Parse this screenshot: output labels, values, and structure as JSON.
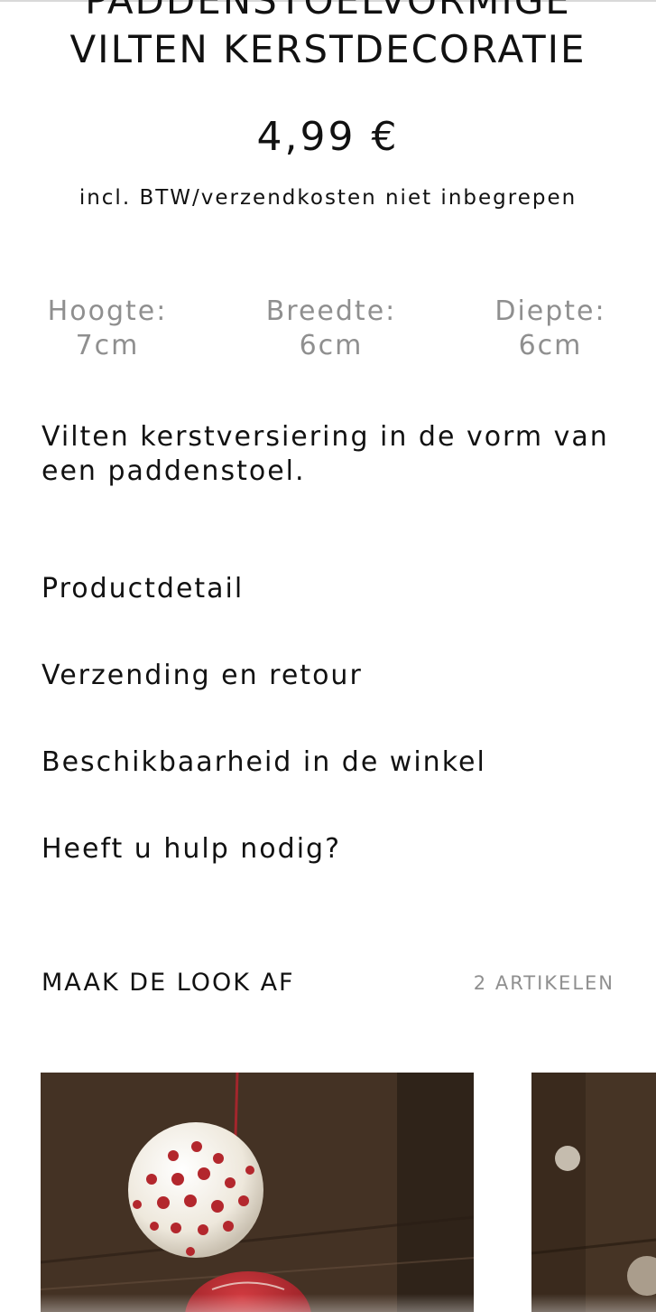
{
  "product": {
    "title_line_1": "PADDENSTOELVORMIGE",
    "title_line_2": "VILTEN KERSTDECORATIE",
    "price": "4,99 €",
    "tax_note": "incl. BTW/verzendkosten niet inbegrepen",
    "dimensions": [
      {
        "label": "Hoogte:",
        "value": "7cm"
      },
      {
        "label": "Breedte:",
        "value": "6cm"
      },
      {
        "label": "Diepte:",
        "value": "6cm"
      }
    ],
    "description": "Vilten kerstversiering in de vorm van een paddenstoel."
  },
  "sections": [
    {
      "label": "Productdetail"
    },
    {
      "label": "Verzending en retour"
    },
    {
      "label": "Beschikbaarheid in de winkel"
    },
    {
      "label": "Heeft u hulp nodig?"
    }
  ],
  "complete_look": {
    "title": "MAAK DE LOOK AF",
    "count": "2 ARTIKELEN",
    "items": [
      {
        "image": "felt-ball-ornament-photo"
      },
      {
        "image": "felt-ornament-photo"
      }
    ]
  },
  "colors": {
    "text": "#111111",
    "muted": "#8f8f8f",
    "background": "#ffffff",
    "felt_red": "#b3272d",
    "felt_white": "#f3efe6"
  }
}
